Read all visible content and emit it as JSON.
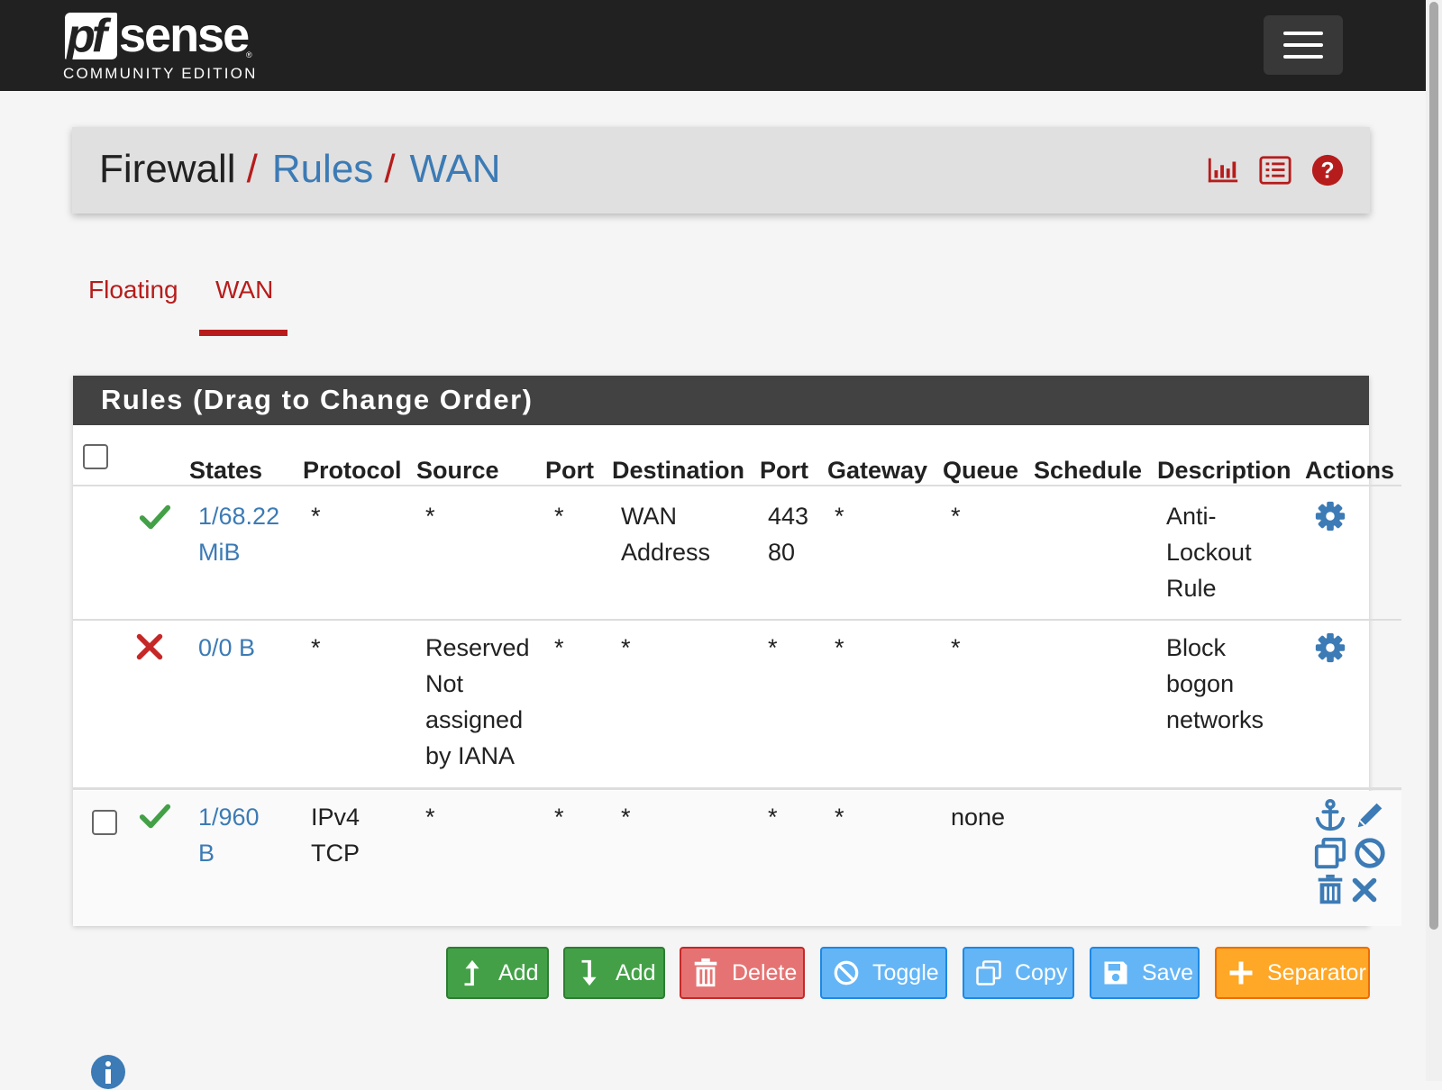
{
  "brand": {
    "logo_pf": "pf",
    "logo_sense": "sense",
    "edition": "COMMUNITY EDITION"
  },
  "breadcrumb": {
    "items": [
      "Firewall",
      "Rules",
      "WAN"
    ],
    "separator": "/"
  },
  "header_icons": [
    "bar-chart-icon",
    "list-icon",
    "help-icon"
  ],
  "tabs": [
    {
      "label": "Floating",
      "active": false
    },
    {
      "label": "WAN",
      "active": true
    }
  ],
  "rules_panel": {
    "title": "Rules (Drag to Change Order)",
    "columns": [
      "States",
      "Protocol",
      "Source",
      "Port",
      "Destination",
      "Port",
      "Gateway",
      "Queue",
      "Schedule",
      "Description",
      "Actions"
    ],
    "rows": [
      {
        "selectable": false,
        "status": "pass",
        "states": "1/68.22\nMiB",
        "protocol": "*",
        "source": "*",
        "source_port": "*",
        "destination": "WAN\nAddress",
        "dest_port": "443\n80",
        "gateway": "*",
        "queue": "*",
        "schedule": "",
        "description": "Anti-\nLockout\nRule",
        "actions": [
          "gear-icon"
        ]
      },
      {
        "selectable": false,
        "status": "block",
        "states": "0/0 B",
        "protocol": "*",
        "source": "Reserved\nNot\nassigned\nby IANA",
        "source_port": "*",
        "destination": "*",
        "dest_port": "*",
        "gateway": "*",
        "queue": "*",
        "schedule": "",
        "description": "Block\nbogon\nnetworks",
        "actions": [
          "gear-icon"
        ]
      },
      {
        "selectable": true,
        "status": "pass",
        "states": "1/960\nB",
        "protocol": "IPv4\nTCP",
        "source": "*",
        "source_port": "*",
        "destination": "*",
        "dest_port": "*",
        "gateway": "*",
        "queue": "none",
        "schedule": "",
        "description": "",
        "actions": [
          "anchor-icon",
          "pencil-icon",
          "copy-icon",
          "ban-icon",
          "trash-icon",
          "times-icon"
        ]
      }
    ]
  },
  "buttons": {
    "add_top": "Add",
    "add_bottom": "Add",
    "delete": "Delete",
    "toggle": "Toggle",
    "copy": "Copy",
    "save": "Save",
    "separator": "Separator"
  },
  "colors": {
    "navbar": "#212121",
    "accent_red": "#b71c1c",
    "link_blue": "#3c7bb5",
    "pass_green": "#43a047",
    "block_red": "#c62828",
    "action_blue": "#3c7bb5"
  }
}
